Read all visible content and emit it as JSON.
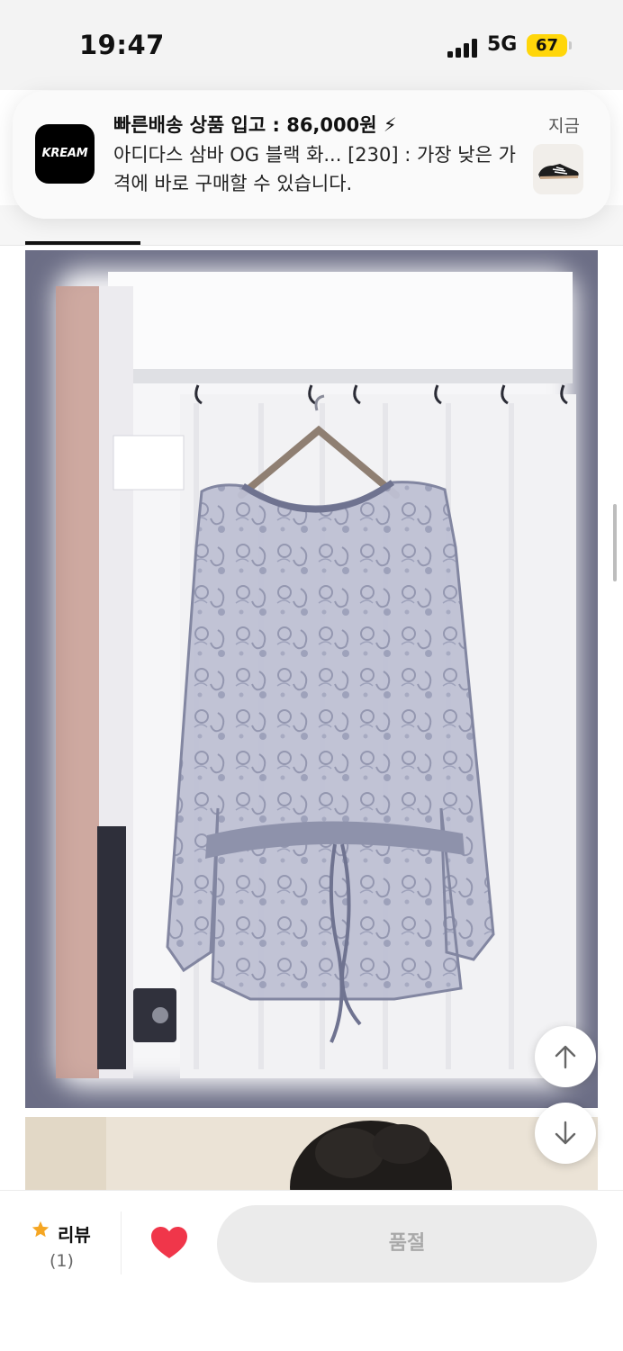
{
  "status_bar": {
    "time": "19:47",
    "network": "5G",
    "battery_level": "67",
    "battery_color": "#ffd60a"
  },
  "notification": {
    "app_icon_text": "KREAM",
    "title": "빠른배송 상품 입고 : 86,000원 ⚡",
    "body": "아디다스 삼바 OG 블랙 화... [230] : 가장 낮은 가격에 바로 구매할 수 있습니다.",
    "time": "지금",
    "thumbnail": "sneaker-thumbnail"
  },
  "gallery": {
    "images": [
      {
        "name": "product-photo-lace-blouse-on-hanger"
      },
      {
        "name": "product-photo-model"
      }
    ]
  },
  "floating_buttons": {
    "up": "arrow-up-icon",
    "down": "arrow-down-icon"
  },
  "bottom_bar": {
    "review_label": "리뷰",
    "review_count": "(1)",
    "like_icon": "heart-icon",
    "like_color": "#f0364a",
    "soldout_label": "품절"
  }
}
